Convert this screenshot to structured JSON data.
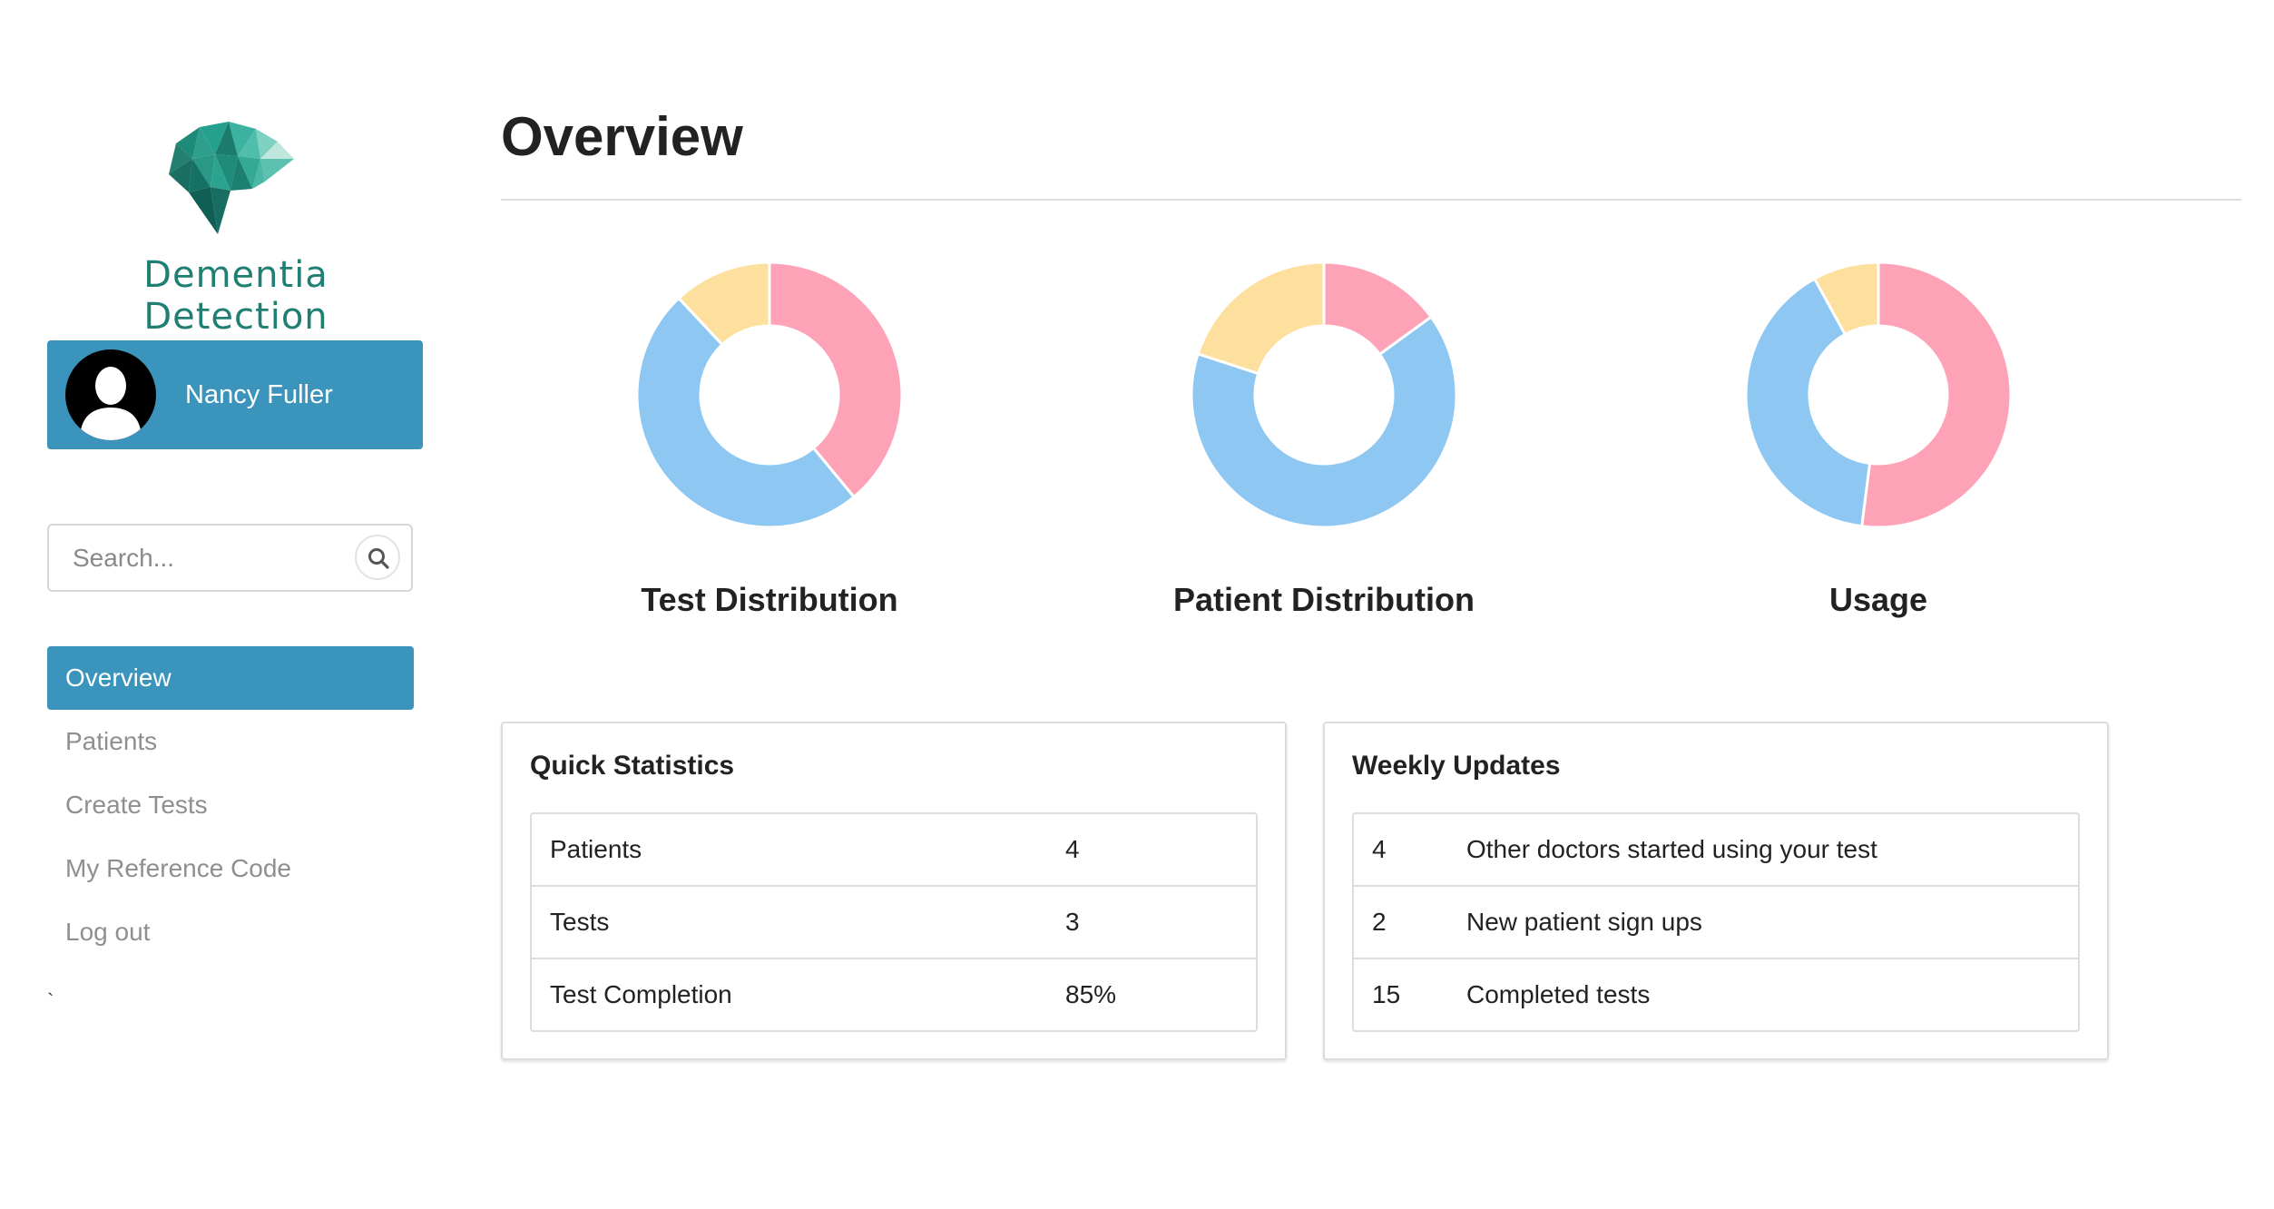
{
  "brand": {
    "name": "Dementia Detection"
  },
  "user": {
    "name": "Nancy Fuller",
    "avatar_icon": "user-silhouette-icon"
  },
  "search": {
    "placeholder": "Search...",
    "icon": "search-icon"
  },
  "nav": {
    "items": [
      {
        "label": "Overview",
        "active": true
      },
      {
        "label": "Patients",
        "active": false
      },
      {
        "label": "Create Tests",
        "active": false
      },
      {
        "label": "My Reference Code",
        "active": false
      },
      {
        "label": "Log out",
        "active": false
      }
    ]
  },
  "stray_mark": "`",
  "page": {
    "title": "Overview"
  },
  "colors": {
    "accent": "#3a94bb",
    "brand_green": "#1f7f72",
    "slice_pink": "#fea2b8",
    "slice_blue": "#8ec8f2",
    "slice_yellow": "#fde09e"
  },
  "chart_data": [
    {
      "type": "pie",
      "title": "Test Distribution",
      "donut": true,
      "values": [
        39,
        49,
        12
      ],
      "colors": [
        "#fea2b8",
        "#8ec8f2",
        "#fde09e"
      ]
    },
    {
      "type": "pie",
      "title": "Patient Distribution",
      "donut": true,
      "values": [
        15,
        65,
        20
      ],
      "colors": [
        "#fea2b8",
        "#8ec8f2",
        "#fde09e"
      ]
    },
    {
      "type": "pie",
      "title": "Usage",
      "donut": true,
      "values": [
        52,
        40,
        8
      ],
      "colors": [
        "#fea2b8",
        "#8ec8f2",
        "#fde09e"
      ]
    }
  ],
  "quick_stats": {
    "title": "Quick Statistics",
    "rows": [
      {
        "label": "Patients",
        "value": "4"
      },
      {
        "label": "Tests",
        "value": "3"
      },
      {
        "label": "Test Completion",
        "value": "85%"
      }
    ]
  },
  "weekly_updates": {
    "title": "Weekly Updates",
    "rows": [
      {
        "count": "4",
        "text": "Other doctors started using your test"
      },
      {
        "count": "2",
        "text": "New patient sign ups"
      },
      {
        "count": "15",
        "text": "Completed tests"
      }
    ]
  }
}
